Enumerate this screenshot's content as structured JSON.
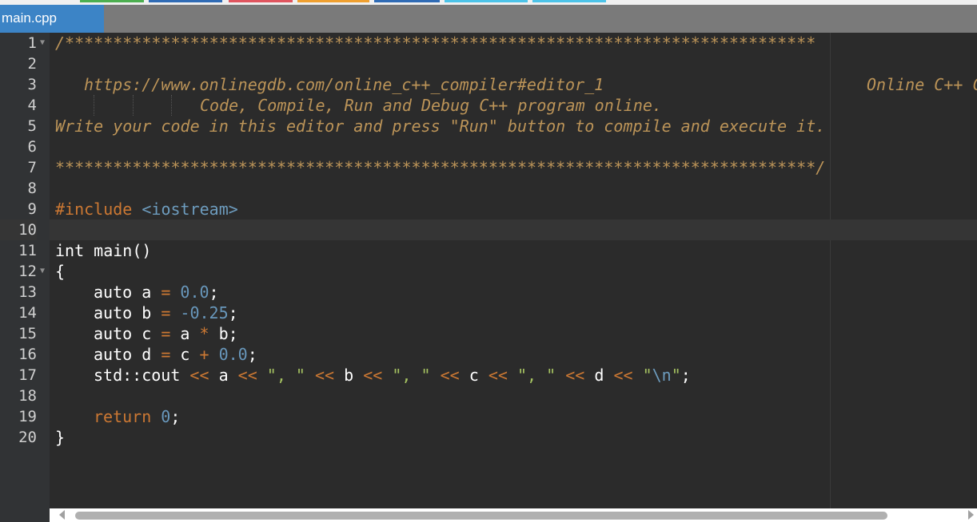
{
  "tab": {
    "label": "main.cpp"
  },
  "accent_colors": [
    "#4caf50",
    "#2f6bb5",
    "#e0555f",
    "#f0a030",
    "#2f6bb5",
    "#4cc3e8",
    "#4cc3e8"
  ],
  "gutter": {
    "numbers": [
      "1",
      "2",
      "3",
      "4",
      "5",
      "6",
      "7",
      "8",
      "9",
      "10",
      "11",
      "12",
      "13",
      "14",
      "15",
      "16",
      "17",
      "18",
      "19",
      "20"
    ]
  },
  "code": {
    "l1": "/******************************************************************************",
    "l3_url": "https://www.onlinegdb.com/online_c++_compiler#editor_1",
    "l3_right": "Online C++ C",
    "l4": "Code, Compile, Run and Debug C++ program online.",
    "l5": "Write your code in this editor and press \"Run\" button to compile and execute it.",
    "l7": "*******************************************************************************/",
    "l9_directive": "#include",
    "l9_header": "<iostream>",
    "l11": "int main()",
    "l12": "{",
    "auto_kw": "auto",
    "var_a": "a",
    "var_b": "b",
    "var_c": "c",
    "var_d": "d",
    "eq": "=",
    "semi": ";",
    "val_a": "0.0",
    "val_b": "-0.25",
    "mul": "*",
    "plus": "+",
    "val_d": "0.0",
    "cout": "std::cout",
    "shl": "<<",
    "sep": "\", \"",
    "nl_q1": "\"",
    "nl_esc": "\\n",
    "nl_q2": "\"",
    "ret_kw": "return",
    "ret_val": "0",
    "l20": "}"
  }
}
